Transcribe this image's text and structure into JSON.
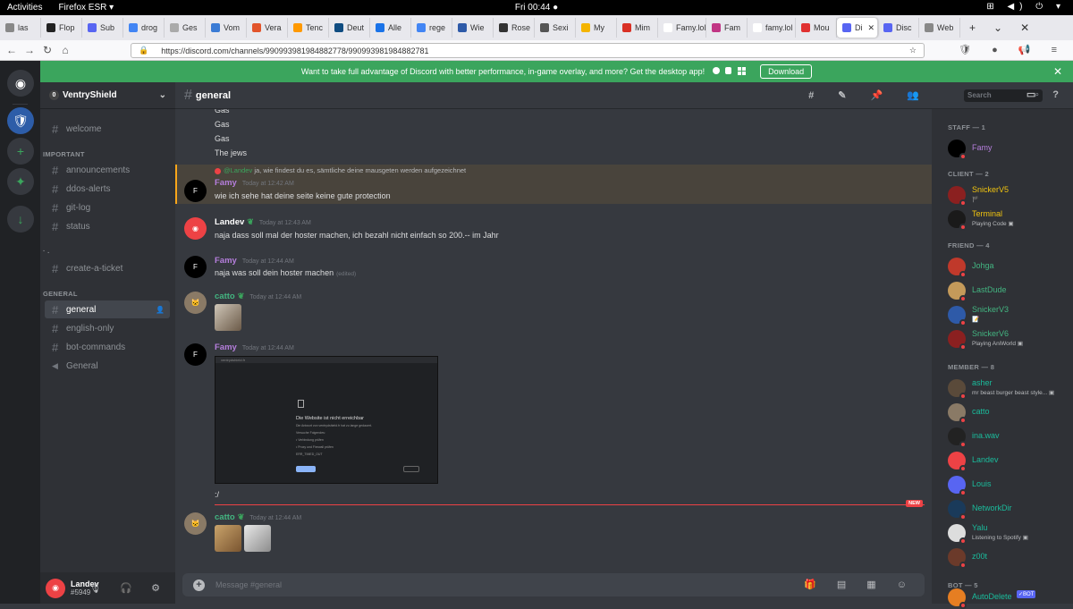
{
  "gnome": {
    "activities": "Activities",
    "app": "Firefox ESR ▾",
    "clock": "Fri 00:44 ●",
    "tray": "⊞ ◀) ⏻ ▾"
  },
  "tabs": [
    {
      "label": "las",
      "color": "#888"
    },
    {
      "label": "Flop",
      "color": "#222"
    },
    {
      "label": "Sub",
      "color": "#5865f2"
    },
    {
      "label": "drog",
      "color": "#4285f4"
    },
    {
      "label": "Ges",
      "color": "#aaa"
    },
    {
      "label": "Vom",
      "color": "#3a7bd5"
    },
    {
      "label": "Vera",
      "color": "#e2542b"
    },
    {
      "label": "Tenc",
      "color": "#ff9900"
    },
    {
      "label": "Deut",
      "color": "#0f4c81"
    },
    {
      "label": "Alle",
      "color": "#1a73e8"
    },
    {
      "label": "rege",
      "color": "#4285f4"
    },
    {
      "label": "Wie",
      "color": "#2e5aa8"
    },
    {
      "label": "Rose",
      "color": "#333"
    },
    {
      "label": "Sexi",
      "color": "#555"
    },
    {
      "label": "My",
      "color": "#f4b400"
    },
    {
      "label": "Mim",
      "color": "#d93025"
    },
    {
      "label": "Famy.lol",
      "color": "#ffffff"
    },
    {
      "label": "Fam",
      "color": "#c13584"
    },
    {
      "label": "famy.lol",
      "color": "#ffffff"
    },
    {
      "label": "Mou",
      "color": "#e03131"
    },
    {
      "label": "Di",
      "color": "#5865f2",
      "active": true
    },
    {
      "label": "Disc",
      "color": "#5865f2"
    },
    {
      "label": "Web",
      "color": "#888"
    }
  ],
  "tab_controls": {
    "new": "+",
    "list": "⌄",
    "close": "✕"
  },
  "nav": {
    "back": "←",
    "forward": "→",
    "reload": "↻",
    "home": "⌂"
  },
  "url": {
    "lock": "🔒",
    "value": "https://discord.com/channels/990993981984882778/990993981984882781",
    "star": "☆"
  },
  "url_icons": "🛡 ● 📢 ≡",
  "banner": {
    "text": "Want to take full advantage of Discord with better performance, in-game overlay, and more? Get the desktop app!",
    "platforms": "  ",
    "download": "Download",
    "close": "✕"
  },
  "guild_icons": {
    "home": "◉",
    "add": "+",
    "explore": "✦",
    "download": "↓",
    "server": "🛡"
  },
  "server": {
    "name": "VentryShield",
    "chevron": "⌄",
    "icon": "0"
  },
  "channels": {
    "welcome": "welcome",
    "cat_important": "IMPORTANT",
    "announcements": "announcements",
    "ddos": "ddos-alerts",
    "gitlog": "git-log",
    "status": "status",
    "cat_blank": "· .",
    "ticket": "create-a-ticket",
    "cat_general": "GENERAL",
    "general": "general",
    "english": "english-only",
    "bot": "bot-commands",
    "voice": "General"
  },
  "user": {
    "name": "Landev",
    "tag": "#5949",
    "controls": "🎙 🎧 ⚙"
  },
  "header": {
    "channel": "general",
    "icons": "# ✎ 📌 👥",
    "search": "Search",
    "search_icon": "⌕",
    "right": "▭ ?"
  },
  "messages": {
    "gas1": "Gas",
    "gas2": "Gas",
    "gas3": "Gas",
    "jews": "The jews",
    "reply_at": "@Landev",
    "reply_text": " ja, wie findest du es, sämtliche deine mausgeten werden aufgezeichnet",
    "famy1_author": "Famy",
    "famy1_ts": "Today at 12:42 AM",
    "famy1_text": "wie ich sehe hat deine seite keine gute protection",
    "landev_author": "Landev",
    "landev_ts": "Today at 12:43 AM",
    "landev_text": "naja dass soll mal der hoster machen, ich bezahl nicht einfach so 200.-- im Jahr",
    "famy2_author": "Famy",
    "famy2_ts": "Today at 12:44 AM",
    "famy2_text": "naja was soll dein hoster machen",
    "edited": "(edited)",
    "catto1_author": "catto",
    "catto1_ts": "Today at 12:44 AM",
    "famy3_author": "Famy",
    "famy3_ts": "Today at 12:44 AM",
    "shot_url": "ventrydshield.fr",
    "shot_title": "Die Website ist nicht erreichbar",
    "shot_sub": "Die Antwort von ventrydshield.fr hat zu lange gedauert.",
    "shot_tips": "Versuche Folgendes:",
    "shot_tip1": "• Verbindung prüfen",
    "shot_tip2": "• Proxy und Firewall prüfen",
    "shot_code": "ERR_TIMED_OUT",
    "slash": ":/",
    "new_tag": "NEW",
    "catto2_author": "catto",
    "catto2_ts": "Today at 12:44 AM",
    "badge": "❦"
  },
  "composer": {
    "placeholder": "Message #general",
    "plus": "+",
    "icons": "🎁 ▤ ▦ ☺"
  },
  "members": {
    "staff": "STAFF — 1",
    "client": "CLIENT — 2",
    "friend": "FRIEND — 4",
    "member": "MEMBER — 8",
    "bot": "BOT — 5",
    "list": [
      {
        "name": "Famy",
        "color": "#b57edc"
      },
      {
        "name": "SnickerV5",
        "color": "#f1c40f",
        "sub": "🏴"
      },
      {
        "name": "Terminal",
        "color": "#f1c40f",
        "sub": "Playing Code ▣"
      },
      {
        "name": "Johga",
        "color": "#43b581"
      },
      {
        "name": "LastDude",
        "color": "#43b581"
      },
      {
        "name": "SnickerV3",
        "color": "#43b581",
        "sub": "📝"
      },
      {
        "name": "SnickerV6",
        "color": "#43b581",
        "sub": "Playing AniWorld ▣"
      },
      {
        "name": "asher",
        "color": "#1abc9c",
        "sub": "mr beast burger beast style... ▣"
      },
      {
        "name": "catto",
        "color": "#1abc9c"
      },
      {
        "name": "ina.wav",
        "color": "#1abc9c"
      },
      {
        "name": "Landev",
        "color": "#1abc9c"
      },
      {
        "name": "Louis",
        "color": "#1abc9c"
      },
      {
        "name": "NetworkDir",
        "color": "#1abc9c"
      },
      {
        "name": "Yalu",
        "color": "#1abc9c",
        "sub": "Listening to Spotify ▣"
      },
      {
        "name": "z00t",
        "color": "#1abc9c"
      },
      {
        "name": "AutoDelete",
        "color": "#1abc9c",
        "bot": "✓BOT"
      }
    ]
  },
  "colors": {
    "green": "#3ba55d",
    "blurple": "#5865f2",
    "red": "#ed4245",
    "famy": "#b57edc",
    "landev": "#ffffff",
    "catto": "#43b581"
  }
}
